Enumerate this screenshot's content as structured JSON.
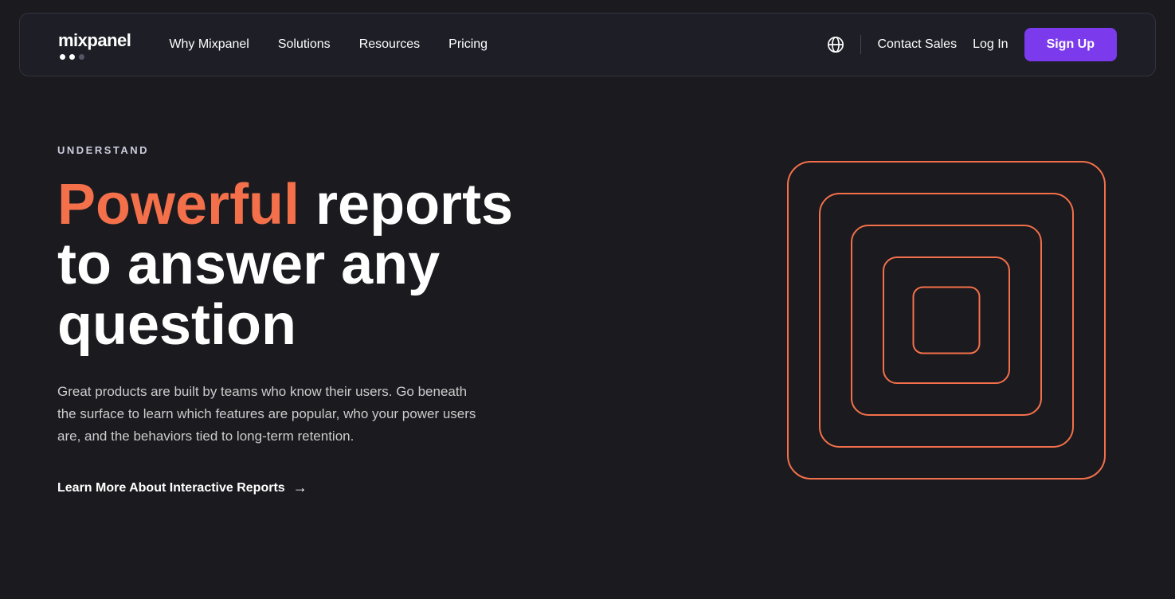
{
  "nav": {
    "logo_text": "mixpanel",
    "links": [
      {
        "label": "Why Mixpanel",
        "id": "why-mixpanel"
      },
      {
        "label": "Solutions",
        "id": "solutions"
      },
      {
        "label": "Resources",
        "id": "resources"
      },
      {
        "label": "Pricing",
        "id": "pricing"
      }
    ],
    "contact_sales": "Contact Sales",
    "log_in": "Log In",
    "sign_up": "Sign Up"
  },
  "hero": {
    "eyebrow": "UNDERSTAND",
    "headline_accent": "Powerful",
    "headline_rest": " reports to answer any question",
    "body": "Great products are built by teams who know their users. Go beneath the surface to learn which features are popular, who your power users are, and the behaviors tied to long-term retention.",
    "cta": "Learn More About Interactive Reports",
    "cta_arrow": "→"
  }
}
